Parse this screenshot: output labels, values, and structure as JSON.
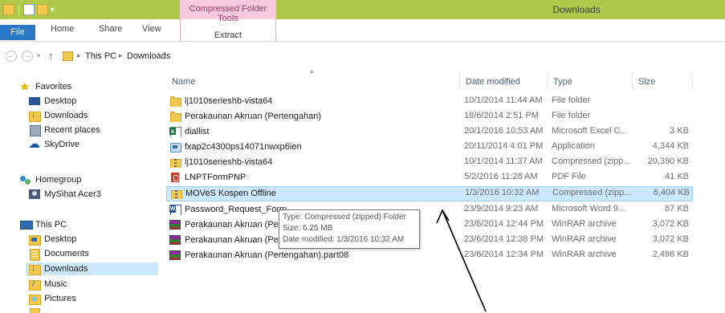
{
  "window": {
    "title": "Downloads",
    "context_tab_group": "Compressed Folder Tools"
  },
  "ribbon": {
    "tabs": [
      "File",
      "Home",
      "Share",
      "View"
    ],
    "context_tab": "Extract"
  },
  "address": {
    "crumbs": [
      "This PC",
      "Downloads"
    ]
  },
  "columns": {
    "name": "Name",
    "date": "Date modified",
    "type": "Type",
    "size": "Size"
  },
  "nav": {
    "favorites": {
      "label": "Favorites",
      "items": [
        "Desktop",
        "Downloads",
        "Recent places",
        "SkyDrive"
      ]
    },
    "homegroup": {
      "label": "Homegroup",
      "items": [
        "MySihat Acer3"
      ]
    },
    "thispc": {
      "label": "This PC",
      "items": [
        "Desktop",
        "Documents",
        "Downloads",
        "Music",
        "Pictures"
      ]
    }
  },
  "files": [
    {
      "name": "lj1010serieshb-vista64",
      "date": "10/1/2014 11:44 AM",
      "type": "File folder",
      "size": "",
      "icon": "folder-icon"
    },
    {
      "name": "Perakaunan Akruan (Pertengahan)",
      "date": "18/6/2014 2:51 PM",
      "type": "File folder",
      "size": "",
      "icon": "folder-icon"
    },
    {
      "name": "diallist",
      "date": "20/1/2016 10:53 AM",
      "type": "Microsoft Excel C...",
      "size": "3 KB",
      "icon": "excel-icon"
    },
    {
      "name": "fxap2c4300ps14071nwxp6ien",
      "date": "20/11/2014 4:01 PM",
      "type": "Application",
      "size": "4,344 KB",
      "icon": "application-icon"
    },
    {
      "name": "lj1010serieshb-vista64",
      "date": "10/1/2014 11:37 AM",
      "type": "Compressed (zipp...",
      "size": "20,390 KB",
      "icon": "zip-folder-icon"
    },
    {
      "name": "LNPTFormPNP",
      "date": "5/2/2016 11:28 AM",
      "type": "PDF File",
      "size": "41 KB",
      "icon": "pdf-icon"
    },
    {
      "name": "MOVeS Kospen Offline",
      "date": "1/3/2016 10:32 AM",
      "type": "Compressed (zipp...",
      "size": "6,404 KB",
      "icon": "zip-folder-icon"
    },
    {
      "name": "Password_Request_Form",
      "date": "23/9/2014 9:23 AM",
      "type": "Microsoft Word 9...",
      "size": "87 KB",
      "icon": "word-icon"
    },
    {
      "name": "Perakaunan Akruan (Pert",
      "date": "23/6/2014 12:44 PM",
      "type": "WinRAR archive",
      "size": "3,072 KB",
      "icon": "winrar-icon"
    },
    {
      "name": "Perakaunan Akruan (Pert",
      "date": "23/6/2014 12:38 PM",
      "type": "WinRAR archive",
      "size": "3,072 KB",
      "icon": "winrar-icon"
    },
    {
      "name": "Perakaunan Akruan (Pertengahan).part08",
      "date": "23/6/2014 12:34 PM",
      "type": "WinRAR archive",
      "size": "2,498 KB",
      "icon": "winrar-icon"
    }
  ],
  "tooltip": {
    "type": "Type: Compressed (zipped) Folder",
    "size": "Size: 6.25 MB",
    "date": "Date modified: 1/3/2016 10:32 AM"
  },
  "colors": {
    "titlebar": "#b0c94a",
    "context_tab": "#f6c9dd",
    "file_tab": "#2b79c6",
    "selection": "#cce8ff"
  }
}
